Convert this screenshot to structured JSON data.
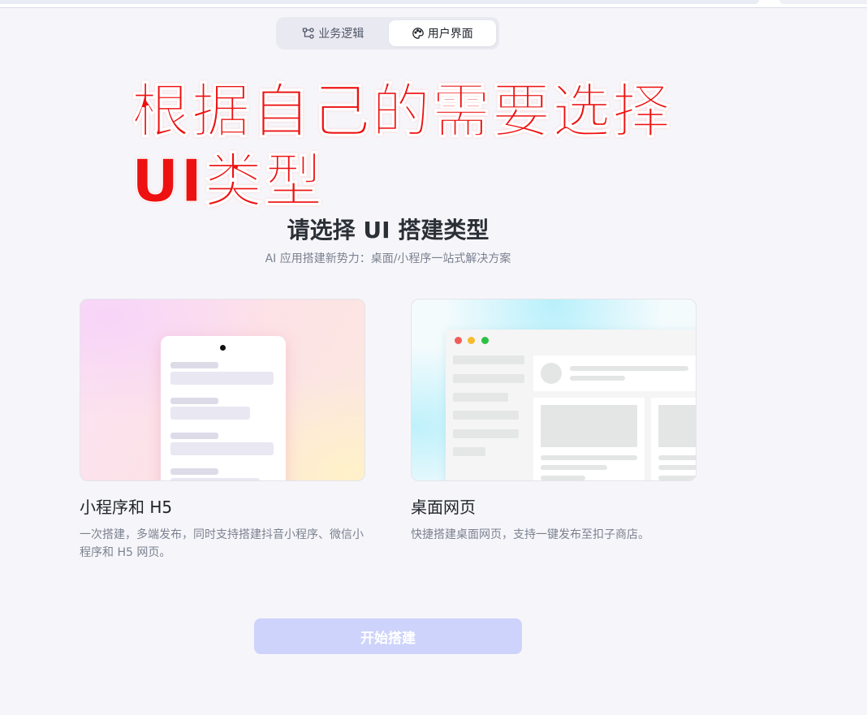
{
  "tabs": [
    {
      "label": "业务逻辑",
      "icon": "flow-nodes-icon"
    },
    {
      "label": "用户界面",
      "icon": "palette-icon",
      "active": true
    }
  ],
  "overlay": {
    "line1": "根据自己的需要选择",
    "line2": "UI类型"
  },
  "header": {
    "title": "请选择 UI 搭建类型",
    "subtitle": "AI 应用搭建新势力：桌面/小程序一站式解决方案"
  },
  "cards": [
    {
      "title": "小程序和 H5",
      "desc": "一次搭建，多端发布，同时支持搭建抖音小程序、微信小程序和 H5 网页。"
    },
    {
      "title": "桌面网页",
      "desc": "快捷搭建桌面网页，支持一键发布至扣子商店。"
    }
  ],
  "start_button": {
    "label": "开始搭建",
    "enabled": false
  },
  "colors": {
    "overlay_red": "#ee1111",
    "button_disabled": "#cdd3fb",
    "window_red": "#f25b57",
    "window_yellow": "#f7bb2e",
    "window_green": "#2cc143"
  }
}
